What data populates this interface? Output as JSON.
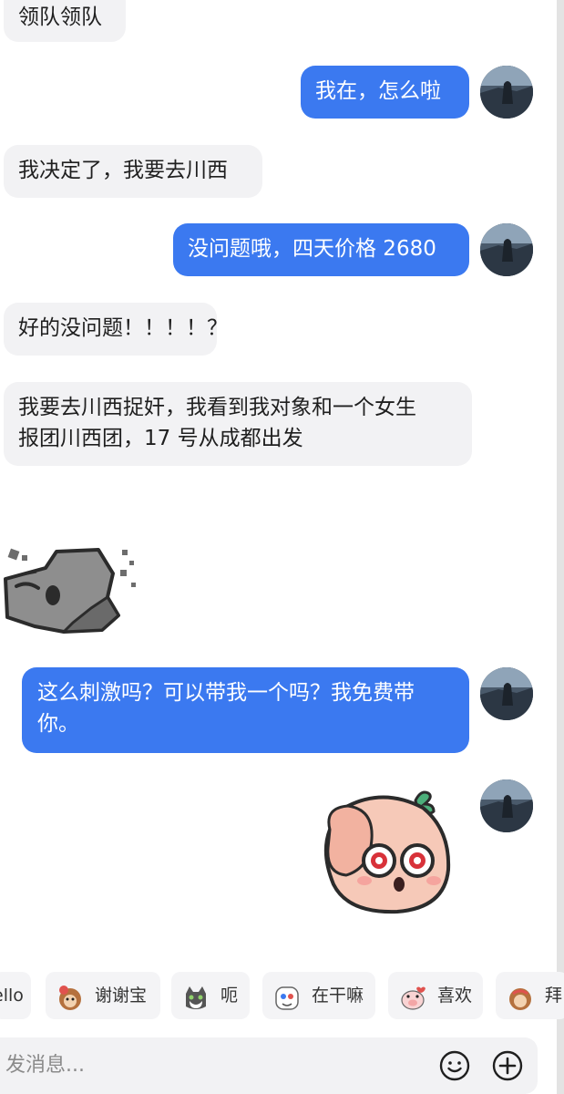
{
  "messages": [
    {
      "side": "in",
      "text": "领队领队"
    },
    {
      "side": "out",
      "text": "我在，怎么啦"
    },
    {
      "side": "in",
      "text": "我决定了，我要去川西"
    },
    {
      "side": "out",
      "text": "没问题哦，四天价格 2680"
    },
    {
      "side": "in",
      "text": "好的没问题！！！！？"
    },
    {
      "side": "in",
      "line1": "我要去川西捉奸，我看到我对象和一个女生",
      "line2": "报团川西团，17 号从成都出发"
    },
    {
      "side": "in",
      "sticker": "crumbling-rock-face-sticker"
    },
    {
      "side": "out",
      "line1": "这么刺激吗？可以带我一个吗？我免费带",
      "line2": "你。"
    },
    {
      "side": "out",
      "sticker": "shocked-peach-sticker"
    }
  ],
  "quick_replies": [
    {
      "label": "ello",
      "icon": "hello-sticker-icon"
    },
    {
      "label": "谢谢宝",
      "icon": "monkey-thanks-icon"
    },
    {
      "label": "呃",
      "icon": "cat-face-icon"
    },
    {
      "label": "在干嘛",
      "icon": "cartoon-face-icon"
    },
    {
      "label": "喜欢",
      "icon": "pig-love-icon"
    },
    {
      "label": "拜",
      "icon": "monkey-bye-icon"
    }
  ],
  "input": {
    "placeholder": "发消息..."
  },
  "colors": {
    "outgoing_bubble": "#3b79f0",
    "incoming_bubble": "#f2f2f4",
    "background": "#ffffff"
  }
}
